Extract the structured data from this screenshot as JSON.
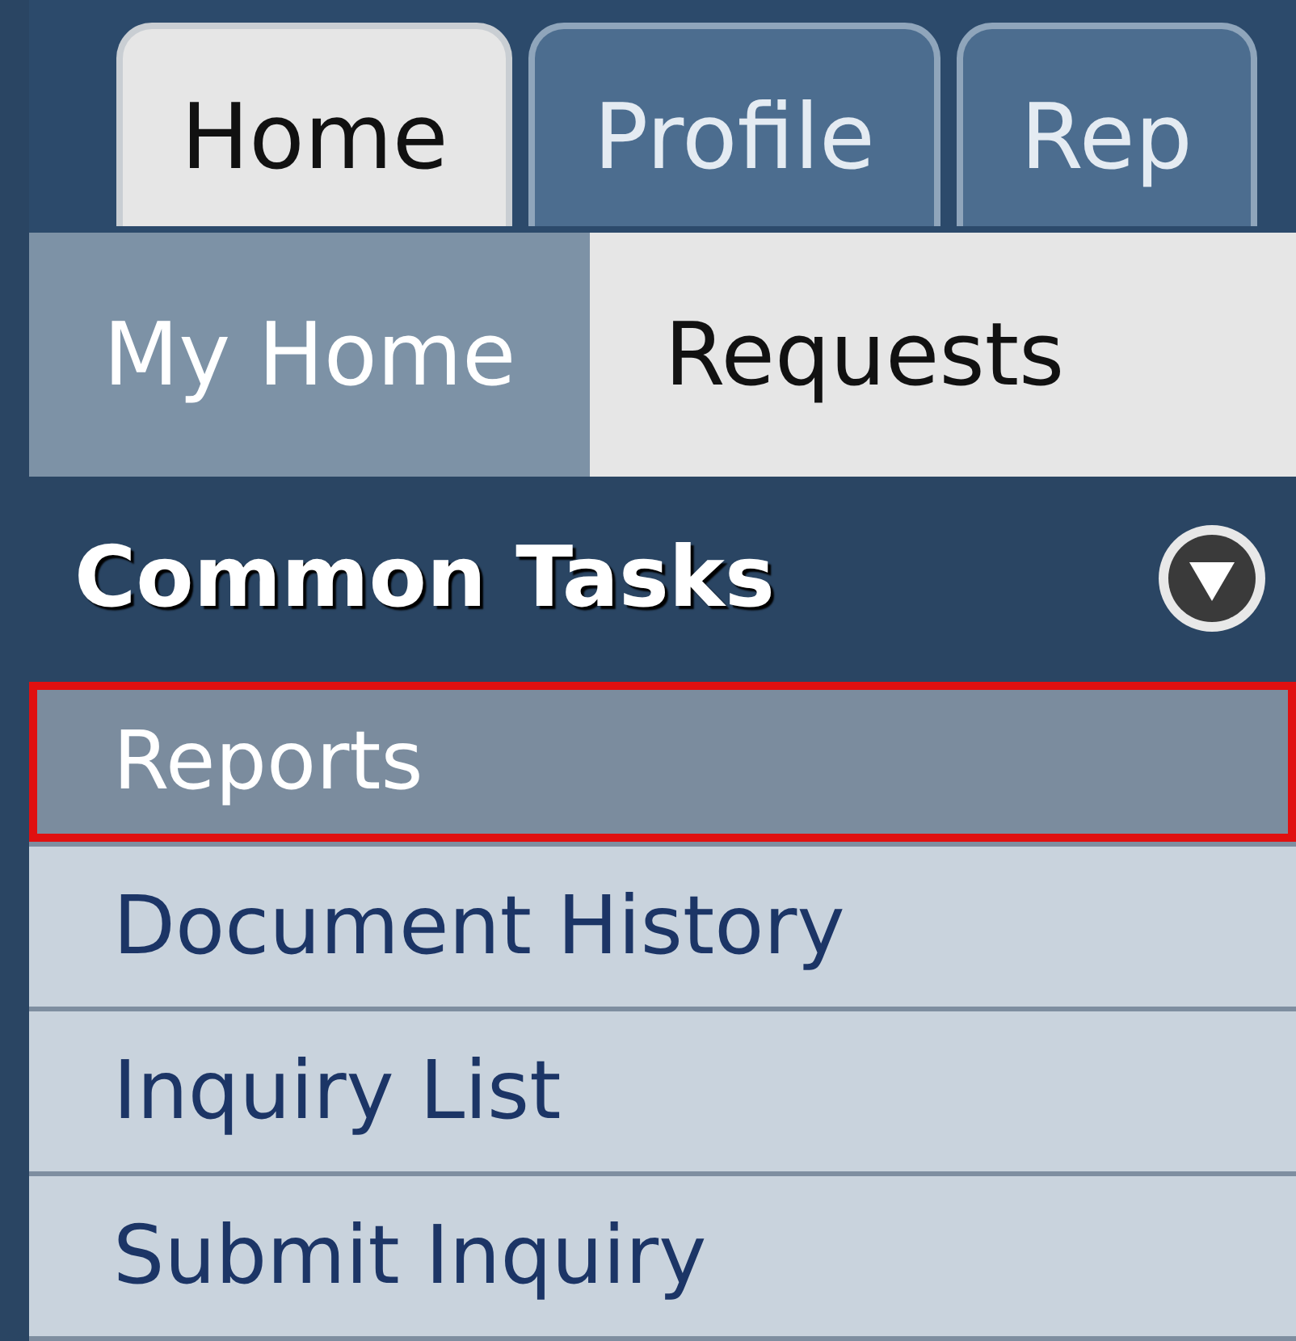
{
  "tabs": [
    {
      "label": "Home",
      "selected": true
    },
    {
      "label": "Profile",
      "selected": false
    },
    {
      "label": "Rep",
      "selected": false
    }
  ],
  "subtabs": [
    {
      "label": "My Home",
      "selected": true
    },
    {
      "label": "Requests",
      "selected": false
    }
  ],
  "panel": {
    "title": "Common Tasks",
    "expanded": true
  },
  "items": [
    {
      "label": "Reports",
      "selected": true,
      "outlined": true
    },
    {
      "label": "Document History",
      "selected": false,
      "outlined": false
    },
    {
      "label": "Inquiry List",
      "selected": false,
      "outlined": false
    },
    {
      "label": "Submit Inquiry",
      "selected": false,
      "outlined": false
    }
  ]
}
